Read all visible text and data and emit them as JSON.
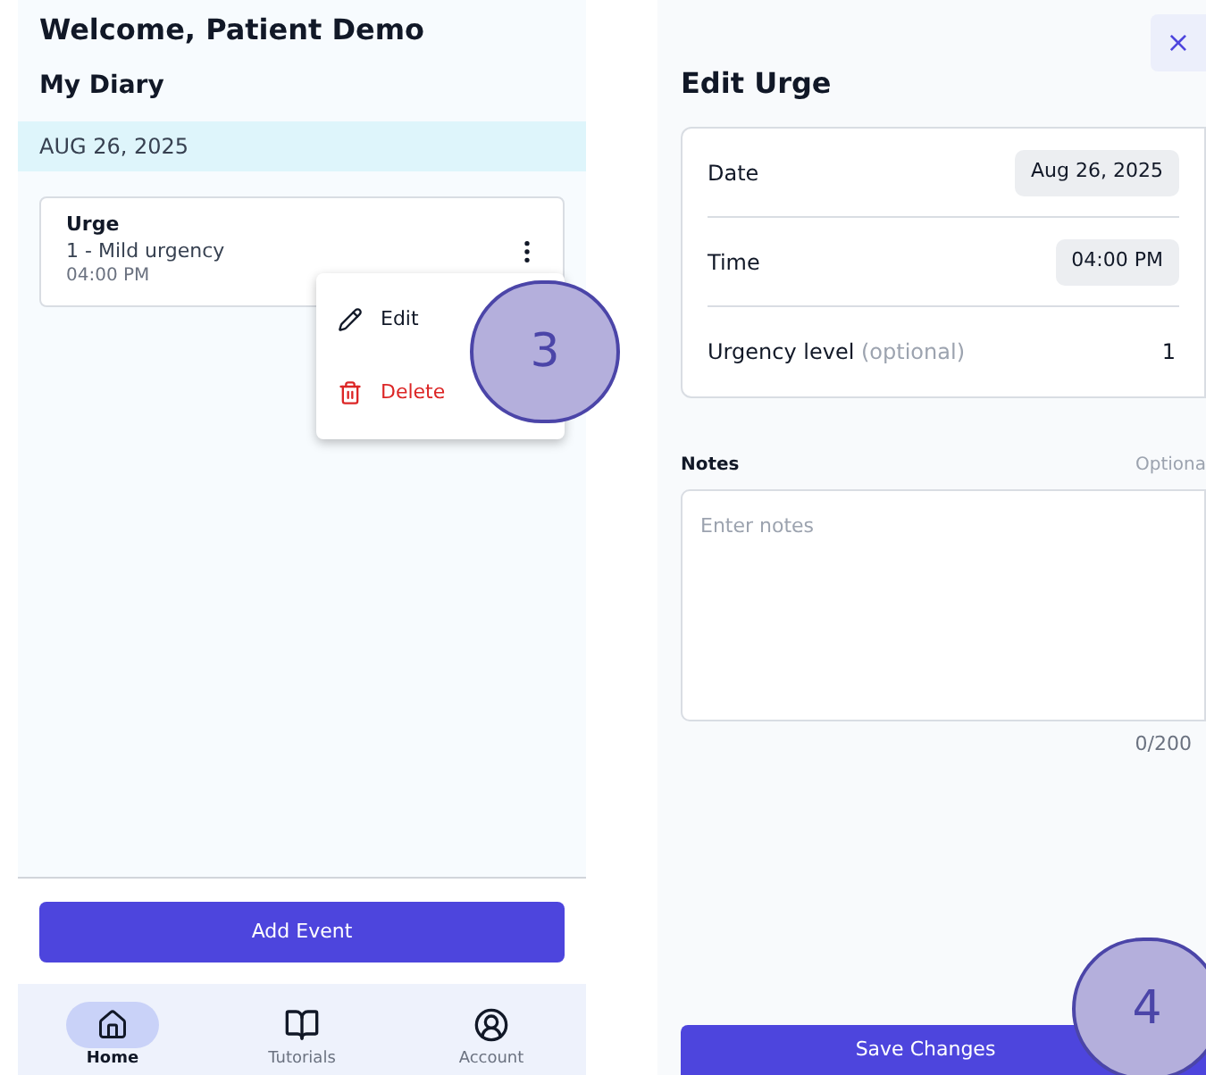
{
  "diary_screen": {
    "welcome": "Welcome, Patient Demo",
    "title": "My Diary",
    "date_header": "AUG 26, 2025",
    "entries": [
      {
        "type": "Urge",
        "level": "1 - Mild urgency",
        "time": "04:00 PM",
        "menu_open": true
      }
    ],
    "menu": [
      {
        "kind": "edit",
        "label": "Edit"
      },
      {
        "kind": "delete",
        "label": "Delete"
      }
    ],
    "add_button": "Add Event",
    "nav": [
      {
        "kind": "home",
        "label": "Home",
        "selected": true
      },
      {
        "kind": "tutorials",
        "label": "Tutorials",
        "selected": false
      },
      {
        "kind": "account",
        "label": "Account",
        "selected": false
      }
    ],
    "step_marker": "3"
  },
  "edit_screen": {
    "close": "×",
    "title": "Edit Urge",
    "fields": [
      {
        "kind": "chip",
        "label": "Date",
        "value": "Aug 26, 2025"
      },
      {
        "kind": "chip",
        "label": "Time",
        "value": "04:00 PM"
      },
      {
        "kind": "plain",
        "label": "Urgency level",
        "hint": "(optional)",
        "value": "1"
      }
    ],
    "notes": {
      "label": "Notes",
      "hint": "Optiona",
      "placeholder": "Enter notes",
      "counter": "0/200"
    },
    "save_button": "Save Changes",
    "step_marker": "4"
  }
}
